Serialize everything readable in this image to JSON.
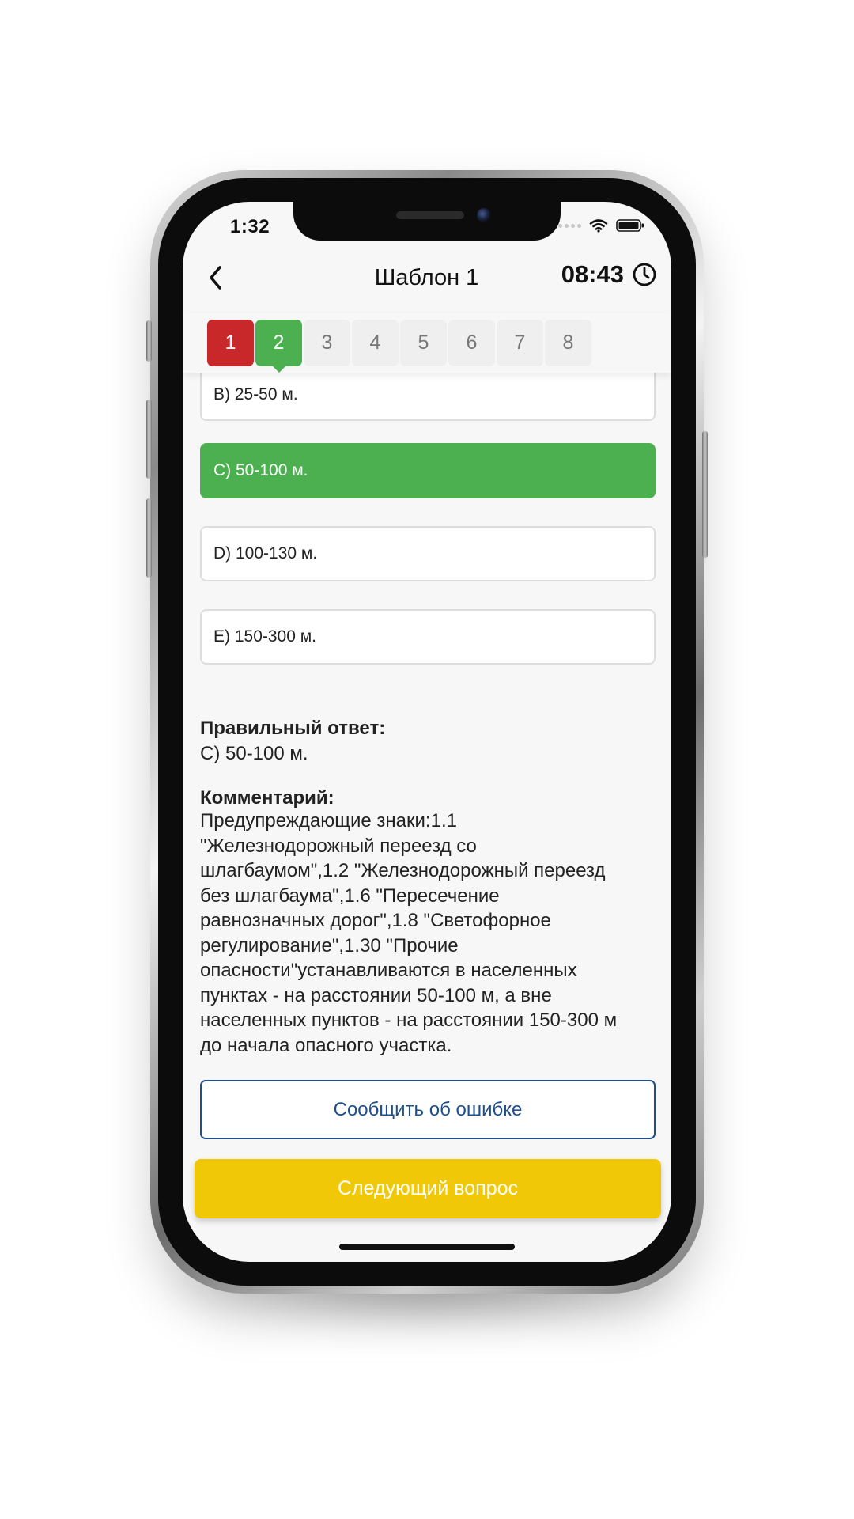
{
  "status_bar": {
    "time": "1:32"
  },
  "header": {
    "back_icon": "chevron-left-icon",
    "title": "Шаблон 1",
    "timer": "08:43",
    "timer_icon": "clock-icon"
  },
  "question_tabs": [
    {
      "label": "1",
      "state": "incorrect"
    },
    {
      "label": "2",
      "state": "correct-active"
    },
    {
      "label": "3",
      "state": "default"
    },
    {
      "label": "4",
      "state": "default"
    },
    {
      "label": "5",
      "state": "default"
    },
    {
      "label": "6",
      "state": "default"
    },
    {
      "label": "7",
      "state": "default"
    },
    {
      "label": "8",
      "state": "default"
    }
  ],
  "answers": [
    {
      "label": "B) 25-50 м.",
      "state": "default"
    },
    {
      "label": "C) 50-100 м.",
      "state": "selected"
    },
    {
      "label": "D) 100-130 м.",
      "state": "default"
    },
    {
      "label": "E) 150-300 м.",
      "state": "default"
    }
  ],
  "correct_answer": {
    "heading": "Правильный ответ:",
    "value": "C) 50-100 м."
  },
  "comment": {
    "heading": "Комментарий:",
    "lines": [
      "Предупреждающие знаки:1.1",
      "\"Железнодорожный переезд со",
      "шлагбаумом\",1.2 \"Железнодорожный переезд",
      "без шлагбаума\",1.6 \"Пересечение",
      "равнозначных дорог\",1.8 \"Светофорное",
      "регулирование\",1.30 \"Прочие",
      "опасности\"устанавливаются в населенных",
      "пунктах - на расстоянии 50-100 м, а вне",
      "населенных пунктов - на расстоянии 150-300 м",
      "до начала опасного участка."
    ]
  },
  "buttons": {
    "report": "Сообщить об ошибке",
    "next": "Следующий вопрос"
  },
  "colors": {
    "correct": "#4caf50",
    "incorrect": "#c9282a",
    "next_button": "#f0c808",
    "report_border": "#1f4f8a"
  }
}
